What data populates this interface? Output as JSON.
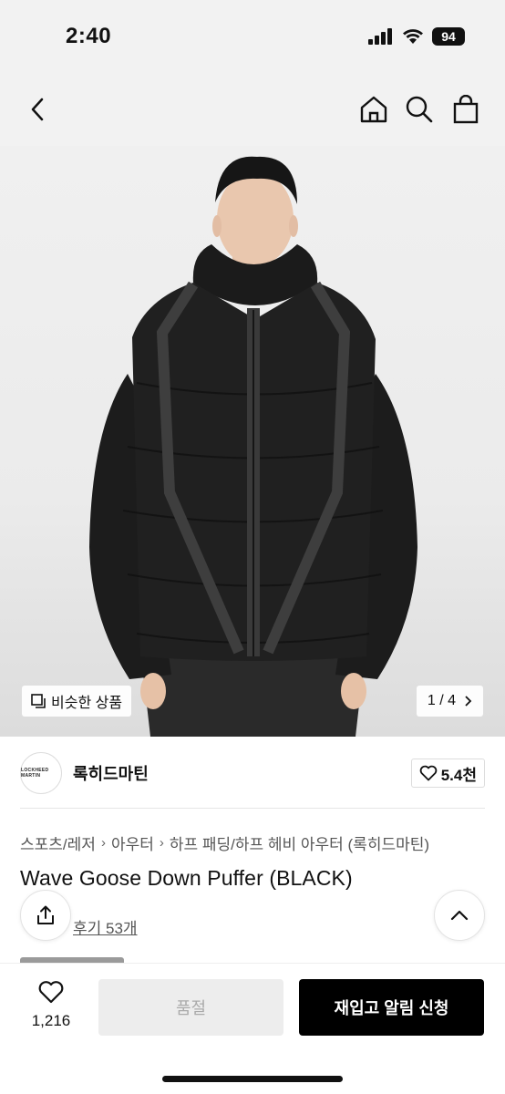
{
  "status": {
    "time": "2:40",
    "battery": "94"
  },
  "nav": {
    "back_icon": "chevron-left-icon",
    "home_icon": "home-icon",
    "search_icon": "search-icon",
    "cart_icon": "shopping-bag-icon"
  },
  "hero": {
    "similar_label": "비슷한 상품",
    "page_indicator": "1 / 4"
  },
  "brand": {
    "logo_text": "LOCKHEED MARTIN",
    "name": "록히드마틴",
    "likes": "5.4천"
  },
  "breadcrumb": [
    "스포츠/레저",
    "아우터",
    "하프 패딩/하프 헤비 아우터 (록히드마틴)"
  ],
  "product": {
    "title": "Wave Goose Down Puffer (BLACK)",
    "reviews": "후기 53개"
  },
  "bottom": {
    "wish_count": "1,216",
    "soldout_label": "품절",
    "restock_label": "재입고 알림 신청"
  },
  "colors": {
    "accent": "#000000",
    "disabled": "#ededed"
  }
}
